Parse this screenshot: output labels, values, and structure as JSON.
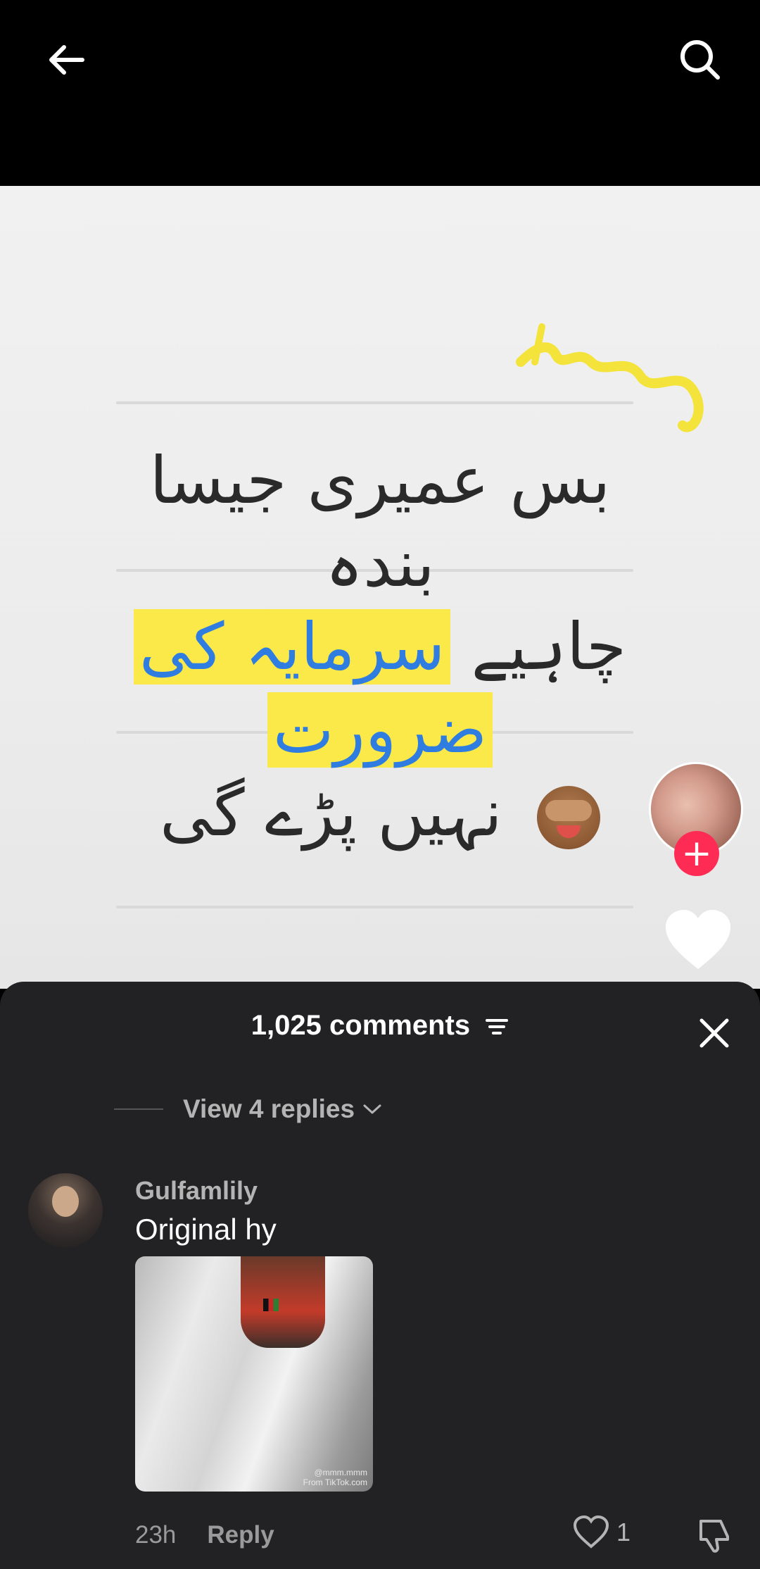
{
  "header": {
    "back_icon": "arrow-left-icon",
    "search_icon": "search-icon"
  },
  "video": {
    "urdu_lines": [
      "بس عمیری جیسا",
      "بندہ",
      "چاہیے",
      "سرمایہ کی",
      "ضرورت",
      "نہیں پڑے گی"
    ],
    "highlight_color": "#fbe94a",
    "highlight_text_color": "#2f7de0",
    "emoji": "see-no-evil-monkey-icon",
    "follow_label": "+"
  },
  "comments_sheet": {
    "title": "1,025 comments",
    "view_replies": "View 4 replies",
    "comment": {
      "username": "Gulfamlily",
      "text": "Original hy",
      "watermark_top": "@mmm.mmm",
      "watermark_bottom": "From TikTok.com",
      "time": "23h",
      "reply_label": "Reply",
      "like_count": "1"
    }
  },
  "colors": {
    "sheet_bg": "#222224",
    "accent_red": "#fe2c55"
  }
}
